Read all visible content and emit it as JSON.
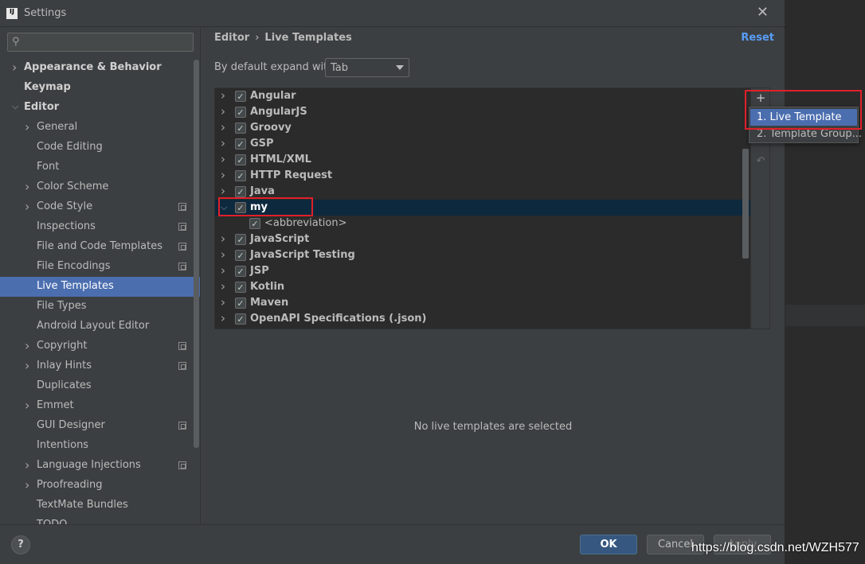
{
  "window": {
    "title": "Settings",
    "app_icon_text": "IJ"
  },
  "sidebar": {
    "search_placeholder": "",
    "items": [
      {
        "label": "Appearance & Behavior",
        "level": 0,
        "chevron": true,
        "bold": true,
        "ext": false
      },
      {
        "label": "Keymap",
        "level": 0,
        "chevron": false,
        "bold": true,
        "ext": false
      },
      {
        "label": "Editor",
        "level": 0,
        "chevron": "down",
        "bold": true,
        "ext": false
      },
      {
        "label": "General",
        "level": 1,
        "chevron": true,
        "ext": false
      },
      {
        "label": "Code Editing",
        "level": 1,
        "chevron": false,
        "ext": false
      },
      {
        "label": "Font",
        "level": 1,
        "chevron": false,
        "ext": false
      },
      {
        "label": "Color Scheme",
        "level": 1,
        "chevron": true,
        "ext": false
      },
      {
        "label": "Code Style",
        "level": 1,
        "chevron": true,
        "ext": true
      },
      {
        "label": "Inspections",
        "level": 1,
        "chevron": false,
        "ext": true
      },
      {
        "label": "File and Code Templates",
        "level": 1,
        "chevron": false,
        "ext": true
      },
      {
        "label": "File Encodings",
        "level": 1,
        "chevron": false,
        "ext": true
      },
      {
        "label": "Live Templates",
        "level": 1,
        "chevron": false,
        "ext": false,
        "selected": true
      },
      {
        "label": "File Types",
        "level": 1,
        "chevron": false,
        "ext": false
      },
      {
        "label": "Android Layout Editor",
        "level": 1,
        "chevron": false,
        "ext": false
      },
      {
        "label": "Copyright",
        "level": 1,
        "chevron": true,
        "ext": true
      },
      {
        "label": "Inlay Hints",
        "level": 1,
        "chevron": true,
        "ext": true
      },
      {
        "label": "Duplicates",
        "level": 1,
        "chevron": false,
        "ext": false
      },
      {
        "label": "Emmet",
        "level": 1,
        "chevron": true,
        "ext": false
      },
      {
        "label": "GUI Designer",
        "level": 1,
        "chevron": false,
        "ext": true
      },
      {
        "label": "Intentions",
        "level": 1,
        "chevron": false,
        "ext": false
      },
      {
        "label": "Language Injections",
        "level": 1,
        "chevron": true,
        "ext": true
      },
      {
        "label": "Proofreading",
        "level": 1,
        "chevron": true,
        "ext": false
      },
      {
        "label": "TextMate Bundles",
        "level": 1,
        "chevron": false,
        "ext": false
      },
      {
        "label": "TODO",
        "level": 1,
        "chevron": false,
        "ext": false
      }
    ]
  },
  "main": {
    "breadcrumb": {
      "parent": "Editor",
      "separator": "›",
      "current": "Live Templates"
    },
    "reset_label": "Reset",
    "expand_label": "By default expand with",
    "expand_value": "Tab",
    "templates": [
      {
        "label": "Angular",
        "expanded": false,
        "checked": true
      },
      {
        "label": "AngularJS",
        "expanded": false,
        "checked": true
      },
      {
        "label": "Groovy",
        "expanded": false,
        "checked": true
      },
      {
        "label": "GSP",
        "expanded": false,
        "checked": true
      },
      {
        "label": "HTML/XML",
        "expanded": false,
        "checked": true
      },
      {
        "label": "HTTP Request",
        "expanded": false,
        "checked": true
      },
      {
        "label": "Java",
        "expanded": false,
        "checked": true
      },
      {
        "label": "my",
        "expanded": true,
        "checked": true,
        "selected": true
      },
      {
        "label": "<abbreviation>",
        "child": true,
        "checked": true
      },
      {
        "label": "JavaScript",
        "expanded": false,
        "checked": true
      },
      {
        "label": "JavaScript Testing",
        "expanded": false,
        "checked": true
      },
      {
        "label": "JSP",
        "expanded": false,
        "checked": true
      },
      {
        "label": "Kotlin",
        "expanded": false,
        "checked": true
      },
      {
        "label": "Maven",
        "expanded": false,
        "checked": true
      },
      {
        "label": "OpenAPI Specifications (.json)",
        "expanded": false,
        "checked": true
      }
    ],
    "side_buttons": {
      "add": "+",
      "undo": "↶"
    },
    "empty_message": "No live templates are selected"
  },
  "popup": {
    "items": [
      {
        "label": "1. Live Template",
        "selected": true
      },
      {
        "label": "2. Template Group...",
        "selected": false
      }
    ]
  },
  "buttons": {
    "help": "?",
    "ok": "OK",
    "cancel": "Cancel",
    "apply": "Apply"
  },
  "watermark": "https://blog.csdn.net/WZH577",
  "colors": {
    "selection": "#4b6eaf",
    "highlight_box": "#e0202a",
    "link": "#589df6",
    "ok_button": "#365880"
  }
}
